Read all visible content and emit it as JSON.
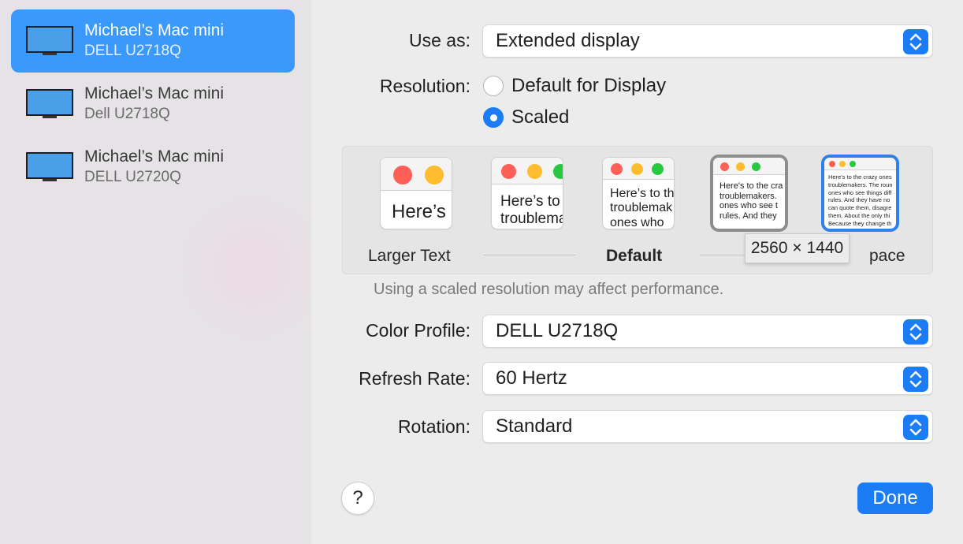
{
  "sidebar": {
    "items": [
      {
        "name": "Michael’s Mac mini",
        "model": "DELL U2718Q",
        "selected": true
      },
      {
        "name": "Michael’s Mac mini",
        "model": "Dell U2718Q",
        "selected": false
      },
      {
        "name": "Michael’s Mac mini",
        "model": "DELL U2720Q",
        "selected": false
      }
    ],
    "icon": "external-display-icon"
  },
  "settings": {
    "use_as": {
      "label": "Use as:",
      "value": "Extended display"
    },
    "resolution": {
      "label": "Resolution:",
      "options": [
        {
          "label": "Default for Display",
          "checked": false
        },
        {
          "label": "Scaled",
          "checked": true
        }
      ]
    },
    "scale": {
      "thumbnails": [
        {
          "text": "Here’s"
        },
        {
          "text": "Here’s to t\ntroublema"
        },
        {
          "text": "Here’s to th\ntroublemak\nones who"
        },
        {
          "text": "Here's to the cra\ntroublemakers.\nones who see t\nrules. And they"
        },
        {
          "text": "Here's to the crazy ones\ntroublemakers. The roun\nones who see things diff\nrules. And they have no\ncan quote them, disagre\nthem. About the only thi\nBecause they change th"
        }
      ],
      "labels": {
        "larger": "Larger Text",
        "default": "Default",
        "more_space": "pace"
      },
      "tooltip": "2560 × 1440",
      "selected_index": 4
    },
    "note": "Using a scaled resolution may affect performance.",
    "color_profile": {
      "label": "Color Profile:",
      "value": "DELL U2718Q"
    },
    "refresh_rate": {
      "label": "Refresh Rate:",
      "value": "60 Hertz"
    },
    "rotation": {
      "label": "Rotation:",
      "value": "Standard"
    }
  },
  "footer": {
    "help": "?",
    "done": "Done"
  },
  "colors": {
    "accent": "#1b7cf6",
    "selection": "#3b99fc"
  }
}
